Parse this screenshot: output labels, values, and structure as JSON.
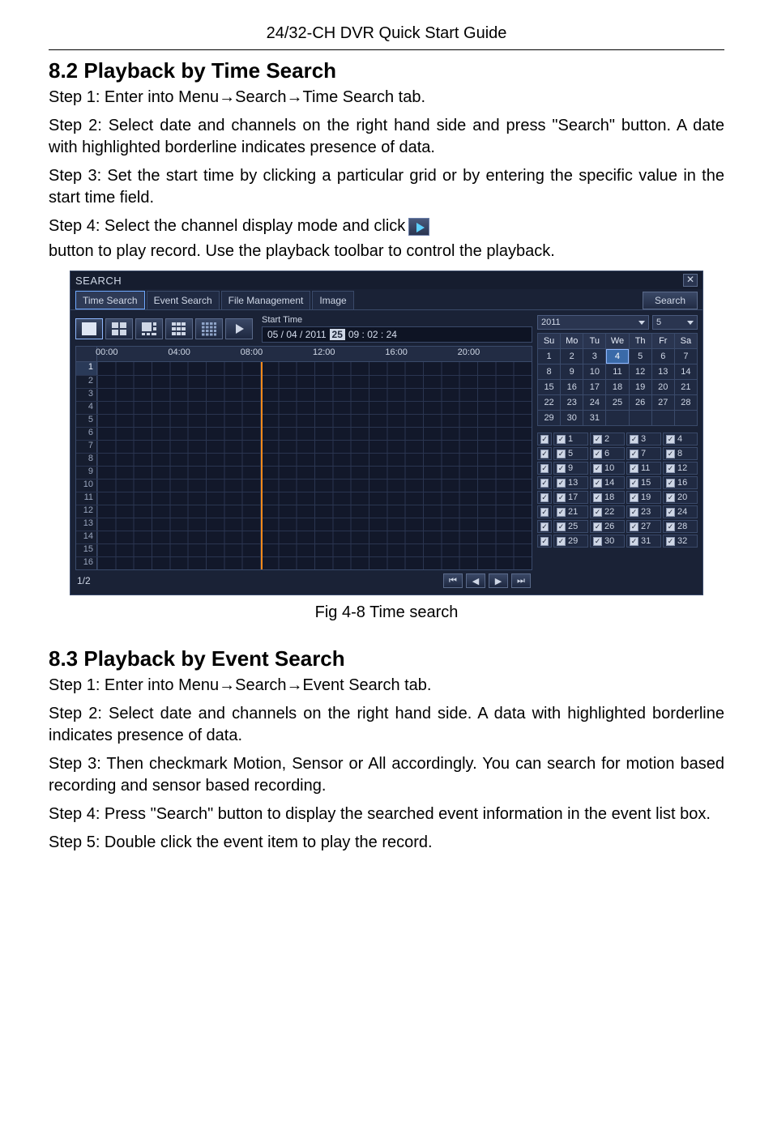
{
  "page_header": "24/32-CH DVR Quick Start Guide",
  "section1": {
    "heading": "8.2  Playback by Time Search",
    "step1": "Step 1: Enter into Menu→Search→Time Search tab.",
    "step2": "Step 2: Select date and channels on the right hand side and press \"Search\" button. A date with highlighted borderline indicates presence of data.",
    "step3": "Step 3: Set the start time by clicking a particular grid or by entering the specific value in the start time field.",
    "step4_a": "Step 4: Select the channel display mode and click",
    "step4_b": "button to play record. Use the playback toolbar to control the playback."
  },
  "dialog": {
    "title": "SEARCH",
    "close": "✕",
    "tabs": [
      "Time Search",
      "Event Search",
      "File Management",
      "Image"
    ],
    "active_tab": 0,
    "search_btn": "Search",
    "start_time_label": "Start Time",
    "start_time": {
      "date_prefix": "05 / 04 / 2011",
      "day": "25",
      "hms": "09 : 02 : 24"
    },
    "hour_labels": [
      "00:00",
      "04:00",
      "08:00",
      "12:00",
      "16:00",
      "20:00"
    ],
    "rows": [
      "1",
      "2",
      "3",
      "4",
      "5",
      "6",
      "7",
      "8",
      "9",
      "10",
      "11",
      "12",
      "13",
      "14",
      "15",
      "16"
    ],
    "selected_row": 0,
    "page_indicator": "1/2",
    "pager_icons": [
      "⏮",
      "◀",
      "▶",
      "⏭"
    ],
    "year": "2011",
    "month": "5",
    "dow": [
      "Su",
      "Mo",
      "Tu",
      "We",
      "Th",
      "Fr",
      "Sa"
    ],
    "calendar_cells": [
      "1",
      "2",
      "3",
      "4",
      "5",
      "6",
      "7",
      "8",
      "9",
      "10",
      "11",
      "12",
      "13",
      "14",
      "15",
      "16",
      "17",
      "18",
      "19",
      "20",
      "21",
      "22",
      "23",
      "24",
      "25",
      "26",
      "27",
      "28",
      "29",
      "30",
      "31",
      "",
      "",
      "",
      ""
    ],
    "selected_day": "4",
    "channels": [
      "1",
      "2",
      "3",
      "4",
      "5",
      "6",
      "7",
      "8",
      "9",
      "10",
      "11",
      "12",
      "13",
      "14",
      "15",
      "16",
      "17",
      "18",
      "19",
      "20",
      "21",
      "22",
      "23",
      "24",
      "25",
      "26",
      "27",
      "28",
      "29",
      "30",
      "31",
      "32"
    ]
  },
  "caption1": "Fig 4-8 Time search",
  "section2": {
    "heading": "8.3  Playback by Event Search",
    "step1": "Step 1: Enter into Menu→Search→Event Search tab.",
    "step2": "Step 2: Select date and channels on the right hand side. A data with highlighted borderline indicates presence of data.",
    "step3": "Step 3: Then checkmark Motion, Sensor or All accordingly. You can search for motion based recording and sensor based recording.",
    "step4": "Step 4: Press \"Search\" button to display the searched event information in the event list box.",
    "step5": "Step 5: Double click the event item to play the record."
  }
}
